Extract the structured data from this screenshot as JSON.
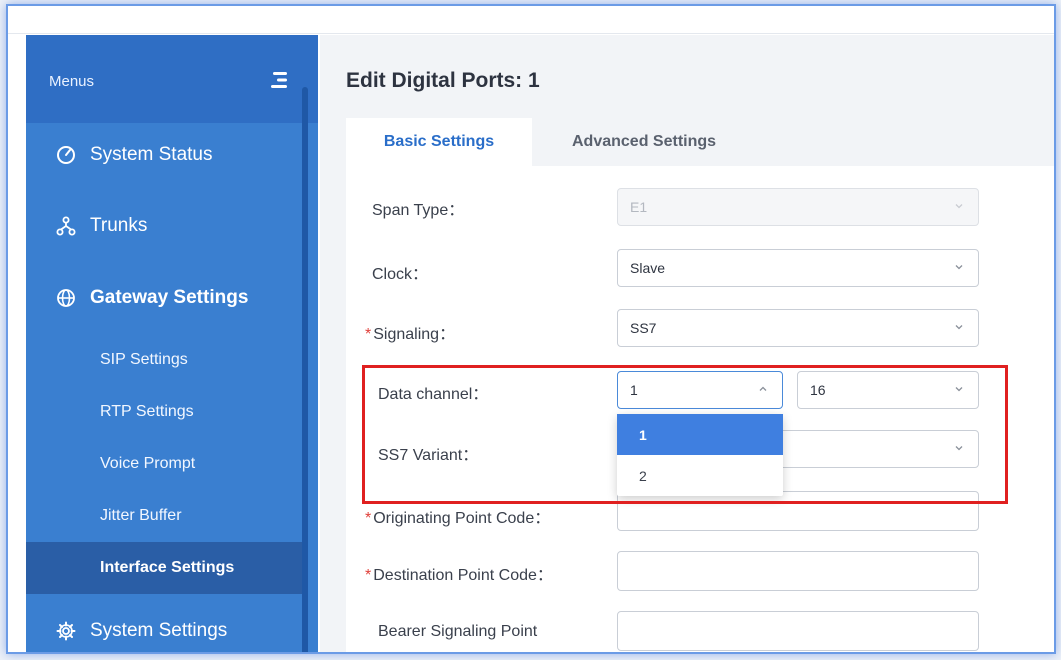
{
  "sidebar": {
    "menus_label": "Menus",
    "items": [
      {
        "label": "System Status",
        "icon": "gauge-icon",
        "type": "top",
        "bold": false
      },
      {
        "label": "Trunks",
        "icon": "trunks-icon",
        "type": "top",
        "bold": false
      },
      {
        "label": "Gateway Settings",
        "icon": "globe-icon",
        "type": "top",
        "bold": true
      },
      {
        "label": "SIP Settings",
        "type": "sub"
      },
      {
        "label": "RTP Settings",
        "type": "sub"
      },
      {
        "label": "Voice Prompt",
        "type": "sub"
      },
      {
        "label": "Jitter Buffer",
        "type": "sub"
      },
      {
        "label": "Interface Settings",
        "type": "sub",
        "active": true
      },
      {
        "label": "System Settings",
        "icon": "gear-icon",
        "type": "top",
        "bold": false
      }
    ]
  },
  "page": {
    "title": "Edit Digital Ports: 1"
  },
  "tabs": [
    {
      "label": "Basic Settings",
      "active": true
    },
    {
      "label": "Advanced Settings",
      "active": false
    }
  ],
  "form": {
    "span_type": {
      "label": "Span Type：",
      "value": "E1",
      "disabled": true
    },
    "clock": {
      "label": "Clock：",
      "value": "Slave"
    },
    "signaling": {
      "label": "Signaling：",
      "value": "SS7",
      "required": true
    },
    "data_channel": {
      "label": "Data channel：",
      "value": "1",
      "value2": "16"
    },
    "ss7_variant": {
      "label": "SS7 Variant："
    },
    "originating_point_code": {
      "label": "Originating Point Code：",
      "required": true
    },
    "destination_point_code": {
      "label": "Destination Point Code：",
      "required": true
    },
    "bearer_signaling_point": {
      "label": "Bearer Signaling Point"
    }
  },
  "dropdown": {
    "options": [
      "1",
      "2"
    ],
    "selected": "1"
  },
  "colors": {
    "sidebar": "#3a7fd0",
    "sidebar_active": "#2a5ea6",
    "accent": "#2a6ec9",
    "highlight_box": "#e02020",
    "dropdown_selected": "#3f7fe0"
  }
}
